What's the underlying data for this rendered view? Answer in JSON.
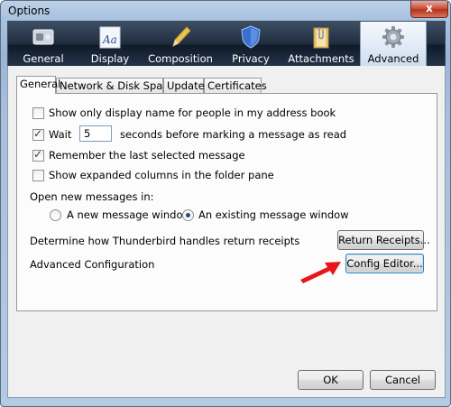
{
  "window": {
    "title": "Options",
    "close_glyph": "x"
  },
  "toolbar": {
    "items": [
      {
        "label": "General",
        "icon": "general-settings-icon"
      },
      {
        "label": "Display",
        "icon": "display-font-icon"
      },
      {
        "label": "Composition",
        "icon": "pencil-icon"
      },
      {
        "label": "Privacy",
        "icon": "shield-icon"
      },
      {
        "label": "Attachments",
        "icon": "paperclip-folder-icon"
      },
      {
        "label": "Advanced",
        "icon": "gear-icon",
        "selected": true
      }
    ]
  },
  "tabs": [
    {
      "label": "General",
      "active": true
    },
    {
      "label": "Network & Disk Space"
    },
    {
      "label": "Update"
    },
    {
      "label": "Certificates"
    }
  ],
  "options": {
    "show_display_name": {
      "label": "Show only display name for people in my address book",
      "checked": false
    },
    "wait": {
      "label": "Wait",
      "value": "5",
      "suffix": "seconds before marking a message as read",
      "checked": true
    },
    "remember_last": {
      "label": "Remember the last selected message",
      "checked": true
    },
    "show_expanded": {
      "label": "Show expanded columns in the folder pane",
      "checked": false
    }
  },
  "open_messages": {
    "heading": "Open new messages in:",
    "new_window": {
      "label": "A new message window",
      "selected": false
    },
    "existing_window": {
      "label": "An existing message window",
      "selected": true
    }
  },
  "receipts": {
    "text": "Determine how Thunderbird handles return receipts",
    "button": "Return Receipts..."
  },
  "advanced_config": {
    "text": "Advanced Configuration",
    "button": "Config Editor..."
  },
  "footer": {
    "ok": "OK",
    "cancel": "Cancel"
  },
  "colors": {
    "arrow": "#e8151b",
    "toolbar_dark": "#1f2c3d",
    "selected_tab": "#dfe9f5"
  }
}
